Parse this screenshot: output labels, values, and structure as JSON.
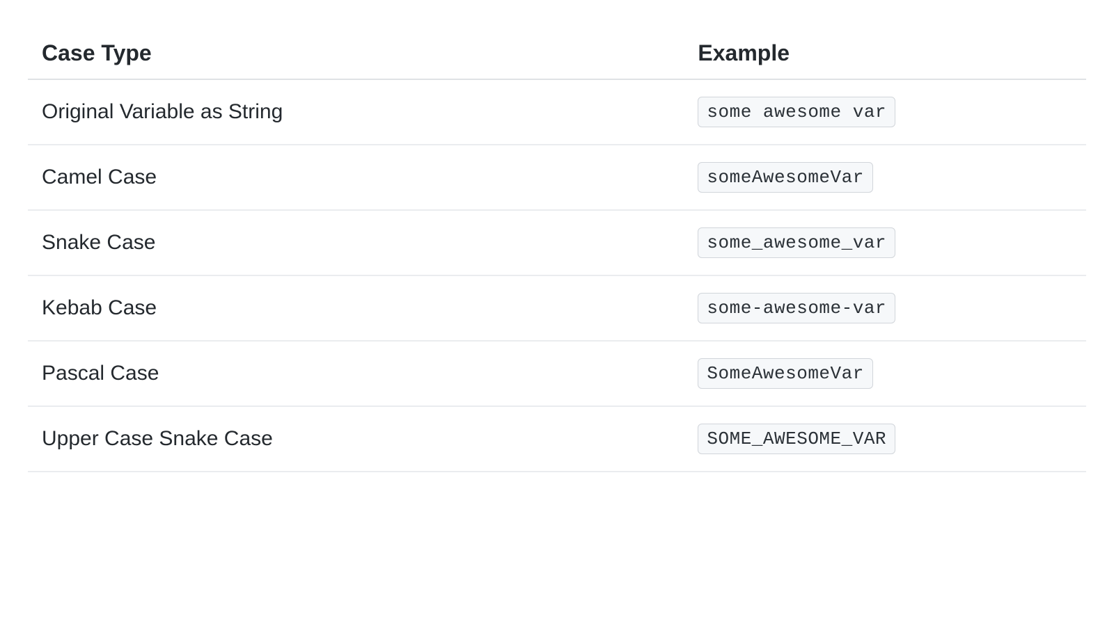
{
  "table": {
    "headers": {
      "case_type": "Case Type",
      "example": "Example"
    },
    "rows": [
      {
        "case_type": "Original Variable as String",
        "example": "some awesome var"
      },
      {
        "case_type": "Camel Case",
        "example": "someAwesomeVar"
      },
      {
        "case_type": "Snake Case",
        "example": "some_awesome_var"
      },
      {
        "case_type": "Kebab Case",
        "example": "some-awesome-var"
      },
      {
        "case_type": "Pascal Case",
        "example": "SomeAwesomeVar"
      },
      {
        "case_type": "Upper Case Snake Case",
        "example": "SOME_AWESOME_VAR"
      }
    ]
  }
}
